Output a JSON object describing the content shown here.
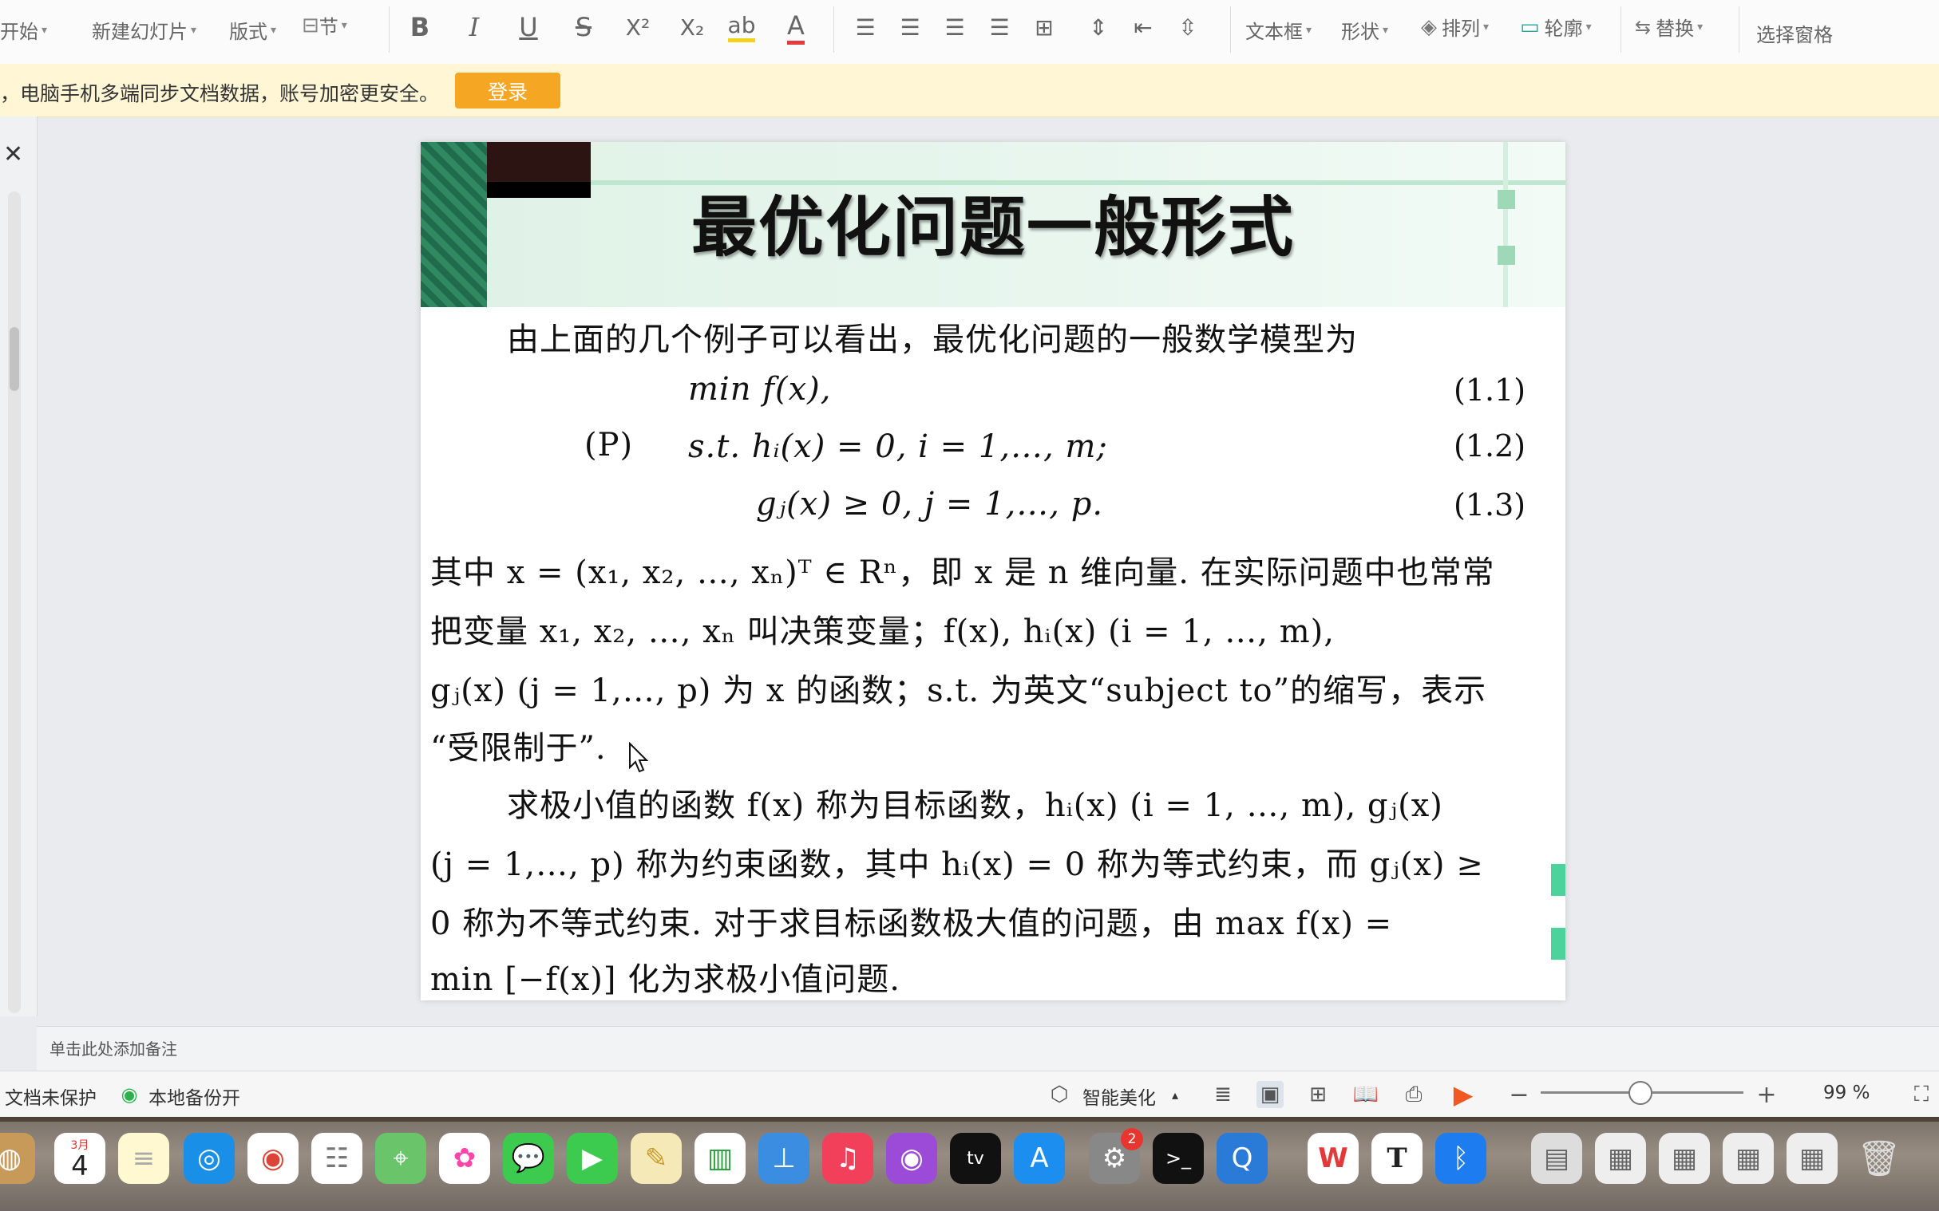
{
  "toolbar": {
    "start_label": "开始",
    "new_slide_label": "新建幻灯片",
    "layout_label": "版式",
    "section_label": "节",
    "textbox_label": "文本框",
    "shape_label": "形状",
    "arrange_label": "排列",
    "outline_label": "轮廓",
    "replace_label": "替换",
    "select_pane_label": "选择窗格",
    "format_buttons": [
      "B",
      "I",
      "U",
      "S",
      "X²",
      "X₂"
    ]
  },
  "notice": {
    "text": "，电脑手机多端同步文档数据，账号加密更安全。",
    "login_label": "登录"
  },
  "slide": {
    "title": "最优化问题一般形式",
    "intro": "由上面的几个例子可以看出，最优化问题的一般数学模型为",
    "eq1": "min f(x),",
    "eq1_no": "(1.1)",
    "p_label": "(P)",
    "eq2": "s.t. hᵢ(x) = 0,    i = 1,…, m;",
    "eq2_no": "(1.2)",
    "eq3": "gⱼ(x) ≥ 0,    j = 1,…, p.",
    "eq3_no": "(1.3)",
    "para1_line1": "其中 x = (x₁, x₂, …, xₙ)ᵀ ∈ Rⁿ，即 x 是 n 维向量. 在实际问题中也常常",
    "para1_line2": "把变量 x₁, x₂, …, xₙ 叫决策变量；f(x), hᵢ(x) (i = 1, …, m),",
    "para1_line3": "gⱼ(x) (j = 1,…, p) 为 x 的函数；s.t. 为英文“subject to”的缩写，表示",
    "para1_line4": "“受限制于”.",
    "para2_line1": "求极小值的函数 f(x) 称为目标函数，hᵢ(x) (i = 1, …, m), gⱼ(x)",
    "para2_line2": "(j = 1,…, p) 称为约束函数，其中 hᵢ(x) = 0 称为等式约束，而 gⱼ(x) ≥",
    "para2_line3": "0 称为不等式约束. 对于求目标函数极大值的问题，由 max f(x) =",
    "para2_line4": "min [−f(x)] 化为求极小值问题."
  },
  "notes": {
    "placeholder": "单击此处添加备注"
  },
  "status": {
    "protect": "文档未保护",
    "backup": "本地备份开",
    "beautify": "智能美化",
    "zoom": "99 %"
  },
  "dock": {
    "calendar_month": "3月",
    "calendar_day": "4",
    "settings_badge": "2"
  }
}
